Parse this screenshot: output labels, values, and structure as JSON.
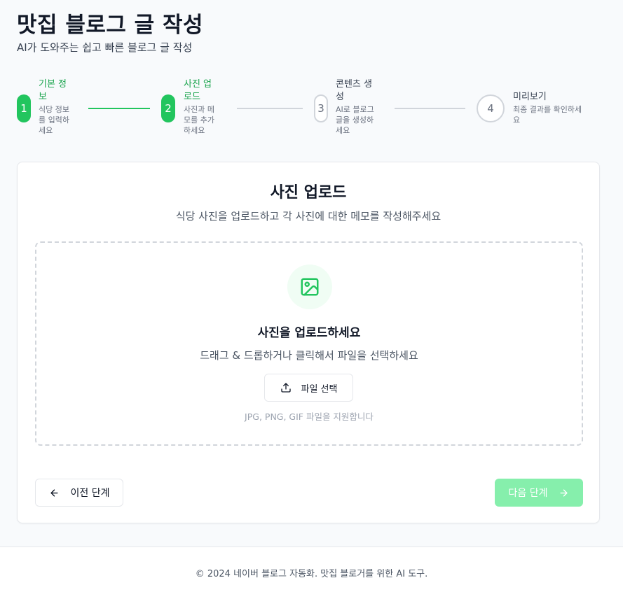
{
  "header": {
    "title": "맛집 블로그 글 작성",
    "subtitle": "AI가 도와주는 쉽고 빠른 블로그 글 작성"
  },
  "steps": [
    {
      "number": "1",
      "title": "기본 정보",
      "title_lines": [
        "기본 정",
        "보"
      ],
      "desc_lines": [
        "식당 정보",
        "를 입력하",
        "세요"
      ],
      "status": "completed"
    },
    {
      "number": "2",
      "title": "사진 업로드",
      "title_lines": [
        "사진 업",
        "로드"
      ],
      "desc_lines": [
        "사진과 메",
        "모를 추가",
        "하세요"
      ],
      "status": "current"
    },
    {
      "number": "3",
      "title": "콘텐츠 생성",
      "title_lines": [
        "콘텐츠 생",
        "성"
      ],
      "desc_lines": [
        "AI로 블로그",
        "글을 생성하",
        "세요"
      ],
      "status": "pending"
    },
    {
      "number": "4",
      "title": "미리보기",
      "title_lines": [
        "미리보기"
      ],
      "desc_lines": [
        "최종 결과를 확인하세",
        "요"
      ],
      "status": "pending"
    }
  ],
  "card": {
    "title": "사진 업로드",
    "subtitle": "식당 사진을 업로드하고 각 사진에 대한 메모를 작성해주세요"
  },
  "dropzone": {
    "icon": "image-icon",
    "title": "사진을 업로드하세요",
    "description": "드래그 & 드롭하거나 클릭해서 파일을 선택하세요",
    "button_label": "파일 선택",
    "button_icon": "upload-icon",
    "note": "JPG, PNG, GIF 파일을 지원합니다"
  },
  "nav": {
    "prev_label": "이전 단계",
    "prev_icon": "arrow-left-icon",
    "next_label": "다음 단계",
    "next_icon": "arrow-right-icon",
    "next_disabled": true
  },
  "footer": {
    "text": "© 2024 네이버 블로그 자동화. 맛집 블로거를 위한 AI 도구."
  },
  "colors": {
    "accent": "#22c55e",
    "accent_text": "#16a34a",
    "accent_disabled": "#86efac",
    "icon_bg": "#f0fdf4"
  }
}
